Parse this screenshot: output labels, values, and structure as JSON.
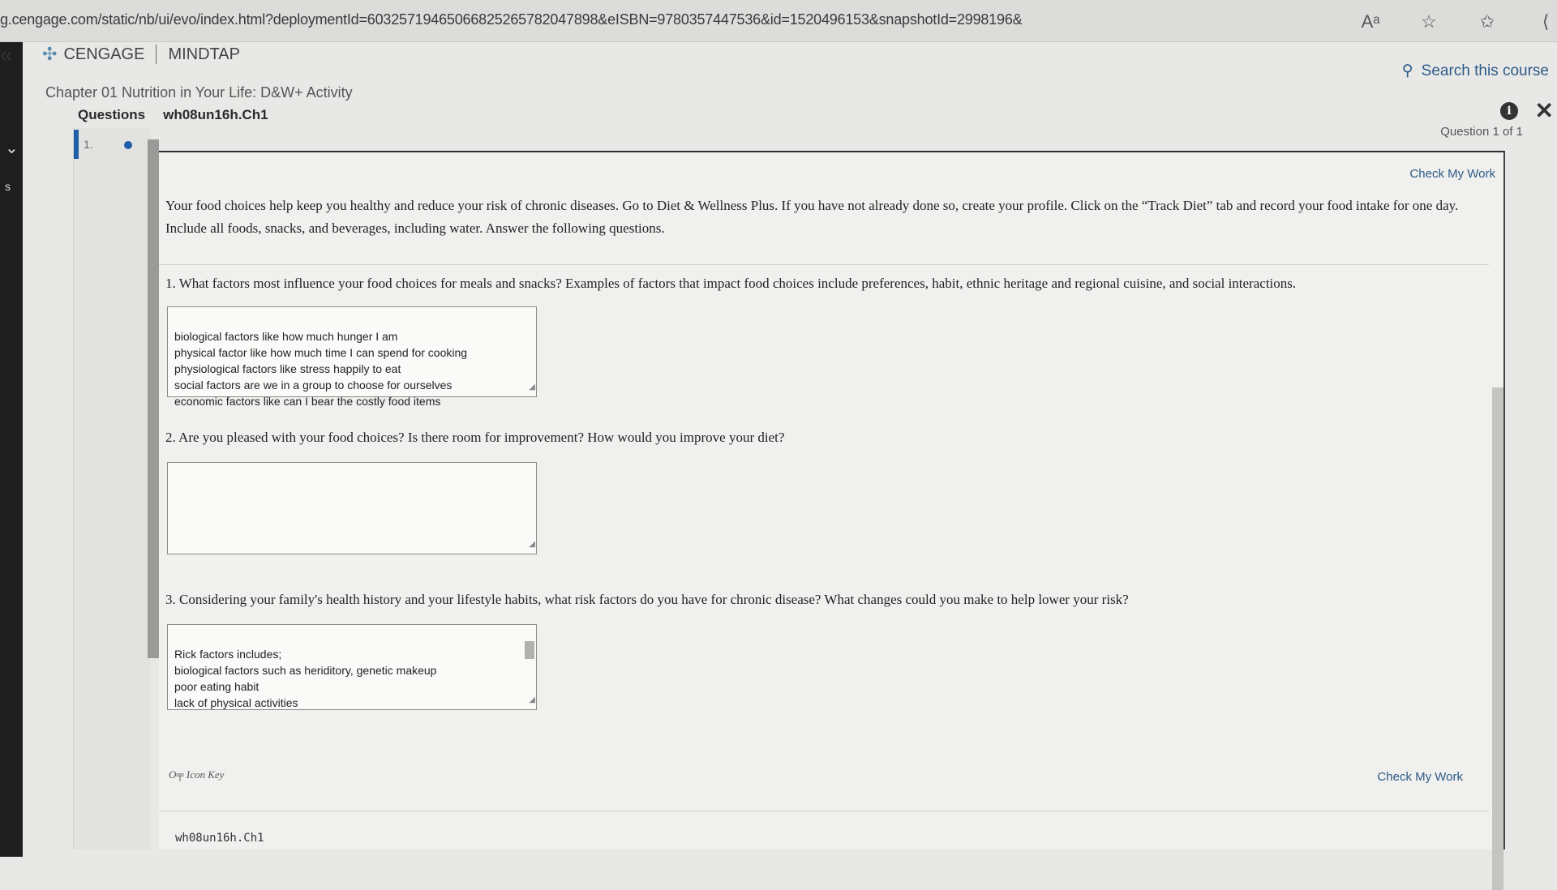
{
  "browser": {
    "url": "g.cengage.com/static/nb/ui/evo/index.html?deploymentId=60325719465066825265782047898&eISBN=9780357447536&id=1520496153&snapshotId=2998196&",
    "icons": [
      "read-aloud-icon",
      "favorite-add-icon",
      "favorites-icon"
    ]
  },
  "header": {
    "brand": "CENGAGE",
    "product": "MINDTAP",
    "search_label": "Search this course",
    "chapter": "Chapter 01 Nutrition in Your Life: D&W+ Activity",
    "tabs": [
      "Questions",
      "wh08un16h.Ch1"
    ],
    "question_count": "Question 1 of 1"
  },
  "nav": {
    "question_number": "1."
  },
  "main": {
    "check_label": "Check My Work",
    "intro": "Your food choices help keep you healthy and reduce your risk of chronic diseases. Go to Diet & Wellness Plus. If you have not already done so, create your profile. Click on the “Track Diet” tab and record your food intake for one day. Include all foods, snacks, and beverages, including water. Answer the following questions.",
    "questions": [
      {
        "text": "1. What factors most influence your food choices for meals and snacks? Examples of factors that impact food choices include preferences, habit, ethnic heritage and regional cuisine, and social interactions.",
        "answer": "biological factors like how much hunger I am\nphysical factor like how much time I can spend for cooking\nphysiological factors like stress happily to eat\nsocial factors are we in a group to choose for ourselves\neconomic factors like can I bear the costly food items"
      },
      {
        "text": "2. Are you pleased with your food choices? Is there room for improvement? How would you improve your diet?",
        "answer": ""
      },
      {
        "text": "3. Considering your family's health history and your lifestyle habits, what risk factors do you have for chronic disease? What changes could you make to help lower your risk?",
        "answer": "Rick factors includes;\nbiological factors such as heriditory, genetic makeup\npoor eating habit\nlack of physical activities"
      }
    ],
    "icon_key": "Icon Key",
    "footer_title": "wh08un16h.Ch1"
  }
}
